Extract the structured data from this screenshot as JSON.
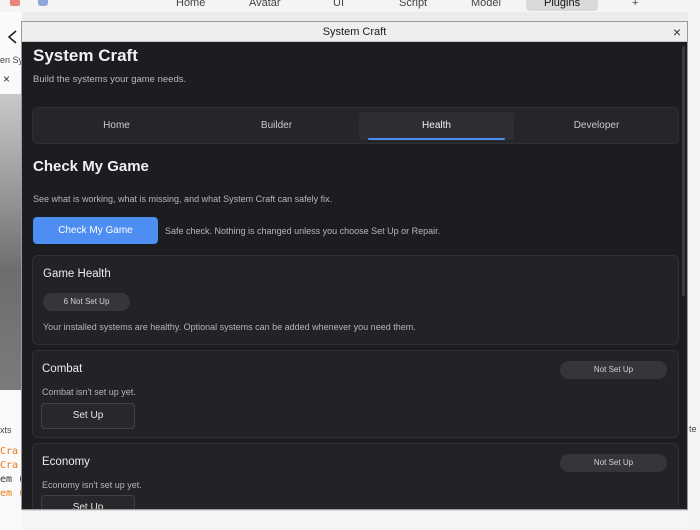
{
  "background": {
    "tabs": [
      "Home",
      "Avatar",
      "UI",
      "Script",
      "Model",
      "Plugins",
      "+"
    ],
    "active_tab": "Plugins",
    "left_snips": [
      "en Sy",
      "xts"
    ],
    "code_lines": [
      {
        "text": "Cra",
        "color": "#e8791c"
      },
      {
        "text": "Cra",
        "color": "#e8791c"
      },
      {
        "text": "em (",
        "color": "#333333"
      },
      {
        "text": "em (",
        "color": "#e8791c"
      }
    ],
    "right_snip": "te"
  },
  "window": {
    "title": "System Craft",
    "close_glyph": "×"
  },
  "header": {
    "title": "System Craft",
    "subtitle": "Build the systems your game needs."
  },
  "tabs": [
    {
      "label": "Home"
    },
    {
      "label": "Builder"
    },
    {
      "label": "Health"
    },
    {
      "label": "Developer"
    }
  ],
  "active_tab": "Health",
  "check": {
    "title": "Check My Game",
    "description": "See what is working, what is missing, and what System Craft can safely fix.",
    "button_label": "Check My Game",
    "note": "Safe check. Nothing is changed unless you choose Set Up or Repair."
  },
  "health_card": {
    "title": "Game Health",
    "badge": "6 Not Set Up",
    "message": "Your installed systems are healthy. Optional systems can be added whenever you need them."
  },
  "systems": [
    {
      "name": "Combat",
      "status": "Not Set Up",
      "message": "Combat isn't set up yet.",
      "button_label": "Set Up"
    },
    {
      "name": "Economy",
      "status": "Not Set Up",
      "message": "Economy isn't set up yet.",
      "button_label": "Set Up"
    }
  ],
  "colors": {
    "accent": "#4e8df2",
    "panel": "#1c1d20",
    "card": "#222327"
  }
}
